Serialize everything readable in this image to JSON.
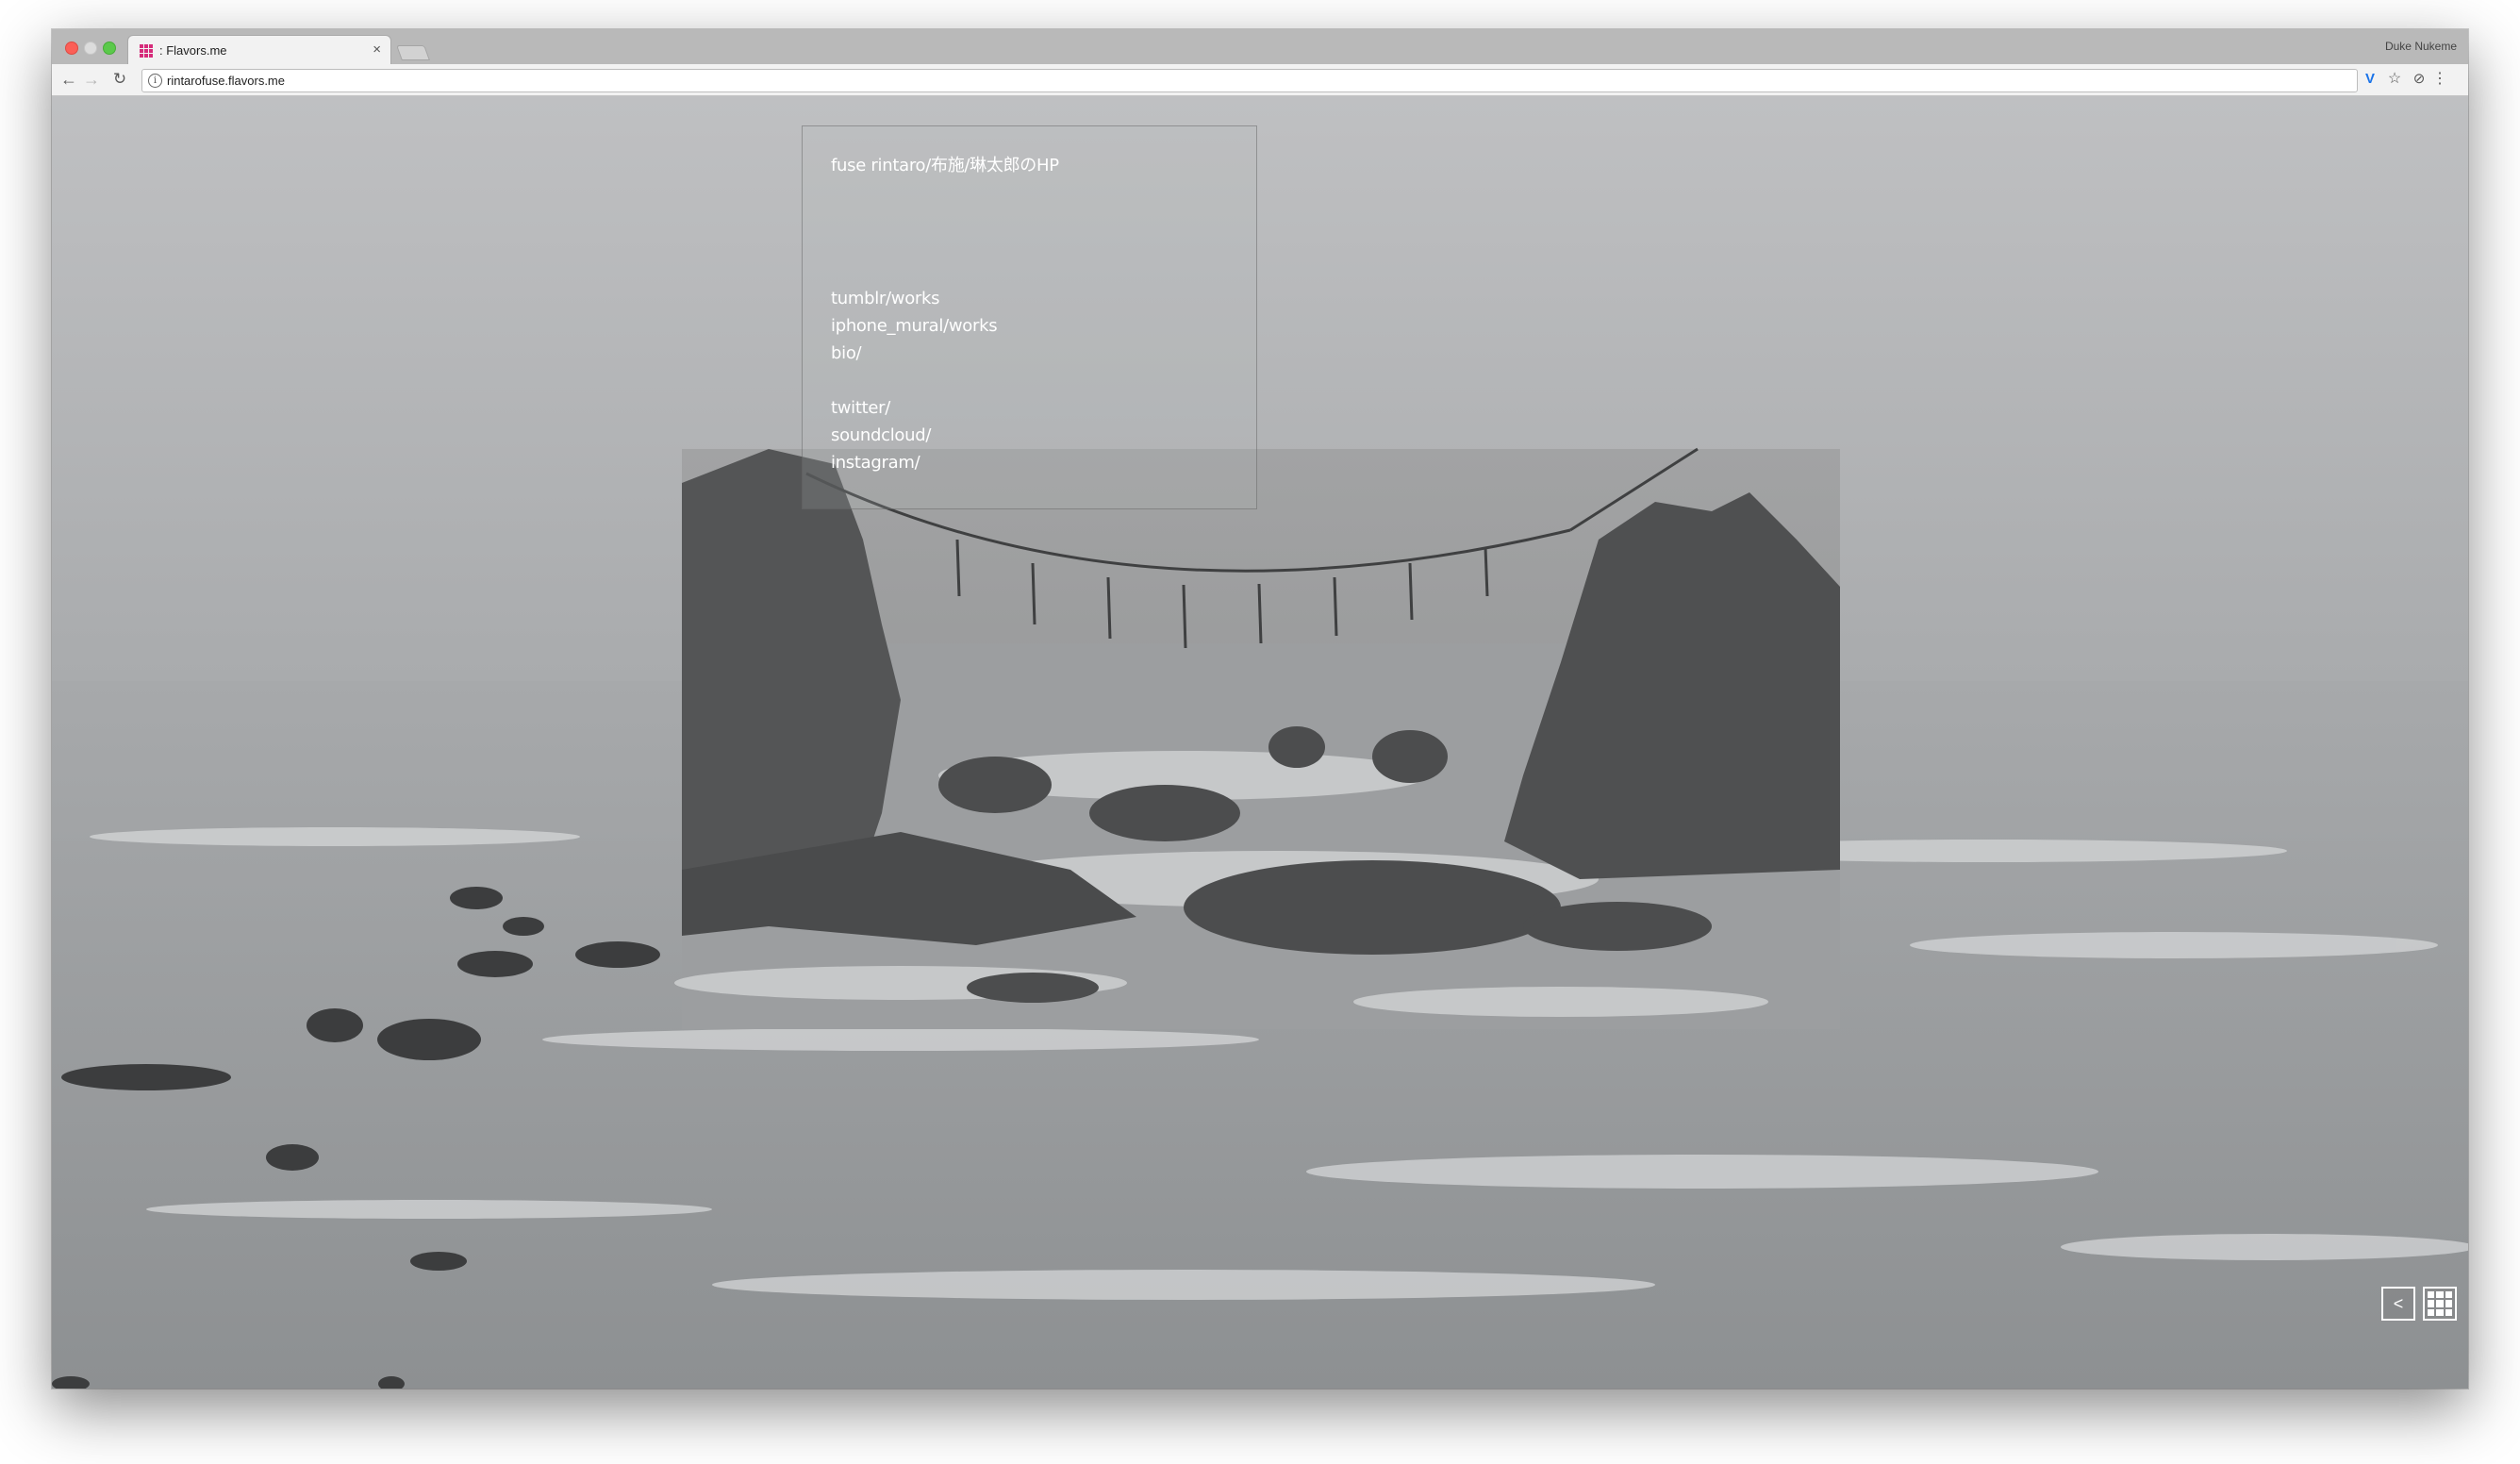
{
  "browser": {
    "tab_title": ": Flavors.me",
    "tab_close": "×",
    "profile_name": "Duke Nukeme",
    "url": "rintarofuse.flavors.me",
    "icons": {
      "back": "arrow-left-icon",
      "forward": "arrow-right-icon",
      "reload": "reload-icon",
      "info": "info-icon",
      "extension_v": "v-extension-icon",
      "star": "star-icon",
      "extension": "extension-icon",
      "menu": "kebab-menu-icon"
    }
  },
  "site": {
    "title": "fuse rintaro/布施/琳太郎のHP",
    "links": [
      {
        "label": "tumblr/works"
      },
      {
        "label": "iphone_mural/works"
      },
      {
        "label": "bio/"
      },
      {
        "label": "twitter/"
      },
      {
        "label": "soundcloud/"
      },
      {
        "label": "instagram/"
      }
    ],
    "corner_icons": [
      "share-icon",
      "grid-icon"
    ]
  },
  "colors": {
    "accent_favicon": "#d62b7a",
    "text": "#ffffff"
  }
}
